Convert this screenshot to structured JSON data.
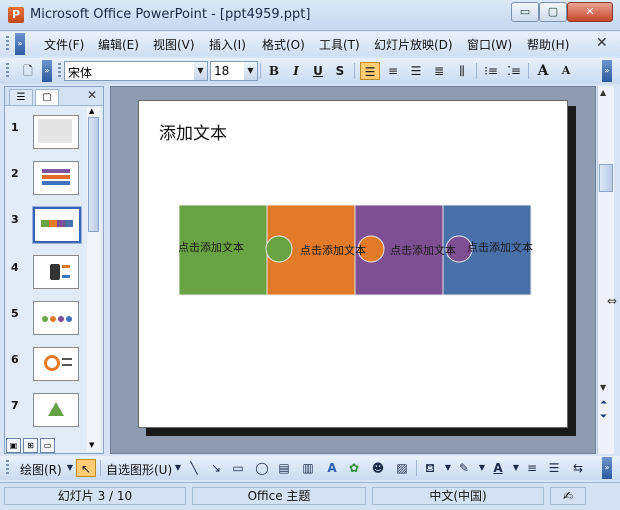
{
  "window": {
    "title": "Microsoft Office PowerPoint - [ppt4959.ppt]",
    "min_label": "▭",
    "max_label": "▢",
    "close_label": "✕"
  },
  "menu": {
    "items": [
      "文件(F)",
      "编辑(E)",
      "视图(V)",
      "插入(I)",
      "格式(O)",
      "工具(T)",
      "幻灯片放映(D)",
      "窗口(W)",
      "帮助(H)"
    ],
    "close_label": "✕"
  },
  "format_toolbar": {
    "font": "宋体",
    "size": "18",
    "bold": "B",
    "italic": "I",
    "underline": "U",
    "shadow": "S",
    "grow_font": "A",
    "shrink_font": "A"
  },
  "slides_panel": {
    "tab_outline": "☰",
    "tab_slides": "▢",
    "close": "✕",
    "slide_numbers": [
      "1",
      "2",
      "3",
      "4",
      "5",
      "6",
      "7"
    ],
    "selected": 3
  },
  "slide": {
    "title": "添加文本",
    "puzzle": [
      {
        "label": "点击添加文本",
        "color": "#6aa344"
      },
      {
        "label": "点击添加文本",
        "color": "#e17b2a"
      },
      {
        "label": "点击添加文本",
        "color": "#7f4f94"
      },
      {
        "label": "点击添加文本",
        "color": "#4a70aa"
      }
    ]
  },
  "draw_toolbar": {
    "draw_label": "绘图(R)",
    "autoshapes_label": "自选图形(U)"
  },
  "status": {
    "slide_info": "幻灯片 3 / 10",
    "theme": "Office 主题",
    "language": "中文(中国)"
  }
}
